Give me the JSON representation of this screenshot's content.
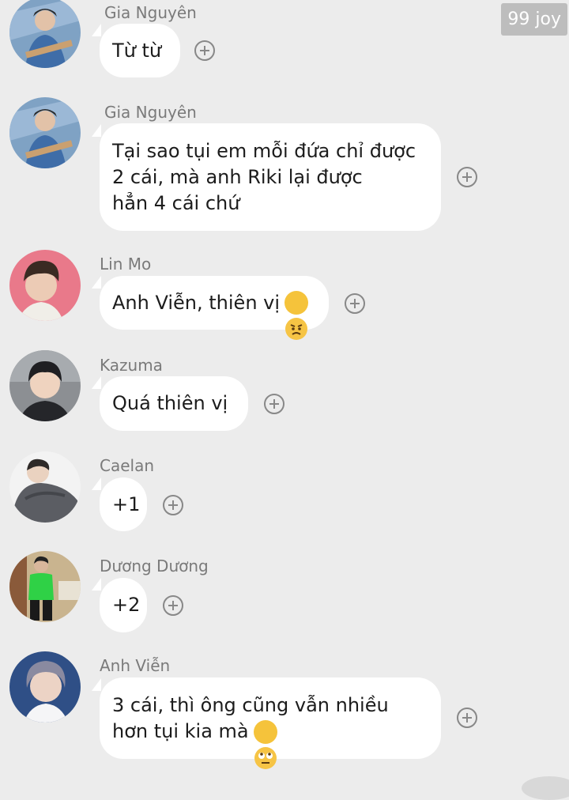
{
  "watermark": "99 joy",
  "messages": [
    {
      "sender": "Gia Nguyên",
      "text": "Từ từ",
      "avatar": "guitar-player-photo"
    },
    {
      "sender": "Gia Nguyên",
      "text": "Tại sao tụi em mỗi đứa chỉ được\n2 cái, mà anh Riki lại được\nhẳn 4 cái chứ",
      "avatar": "guitar-player-photo"
    },
    {
      "sender": "Lin Mo",
      "text": "Anh Viễn, thiên vị",
      "emoji": "angry-face",
      "avatar": "red-background-portrait"
    },
    {
      "sender": "Kazuma",
      "text": "Quá thiên vị",
      "avatar": "smiling-portrait"
    },
    {
      "sender": "Caelan",
      "text": "+1",
      "avatar": "white-hoodie-portrait"
    },
    {
      "sender": "Dương Dương",
      "text": "+2",
      "avatar": "green-jacket-portrait"
    },
    {
      "sender": "Anh Viễn",
      "text": "3 cái, thì ông cũng vẫn nhiều\nhơn tụi kia mà",
      "emoji": "eye-roll-face",
      "avatar": "blue-background-portrait"
    }
  ],
  "colors": {
    "background": "#ececec",
    "bubble": "#ffffff",
    "name": "#7a7a7a"
  }
}
